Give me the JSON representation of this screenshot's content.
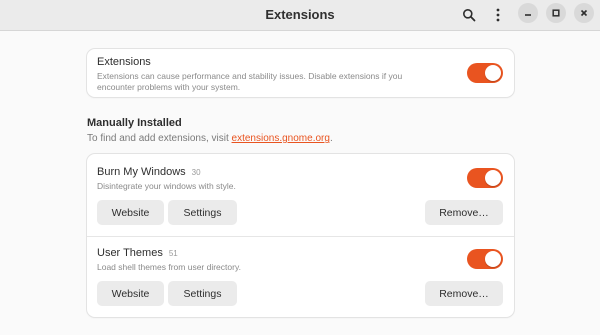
{
  "window": {
    "title": "Extensions"
  },
  "global_toggle": {
    "title": "Extensions",
    "description_line1": "Extensions can cause performance and stability issues. Disable extensions if you",
    "description_line2": "encounter problems with your system.",
    "enabled": true
  },
  "manual_section": {
    "title": "Manually Installed",
    "description_prefix": "To find and add extensions, visit ",
    "link_text": "extensions.gnome.org",
    "description_suffix": "."
  },
  "extensions": [
    {
      "name": "Burn My Windows",
      "version": "30",
      "description": "Disintegrate your windows with style.",
      "enabled": true,
      "website_label": "Website",
      "settings_label": "Settings",
      "remove_label": "Remove…"
    },
    {
      "name": "User Themes",
      "version": "51",
      "description": "Load shell themes from user directory.",
      "enabled": true,
      "website_label": "Website",
      "settings_label": "Settings",
      "remove_label": "Remove…"
    }
  ],
  "colors": {
    "accent": "#e95420",
    "headerbar": "#ebebeb",
    "background": "#fafafa"
  },
  "icons": [
    "search-icon",
    "kebab-menu-icon",
    "minimize-icon",
    "maximize-icon",
    "close-icon"
  ]
}
